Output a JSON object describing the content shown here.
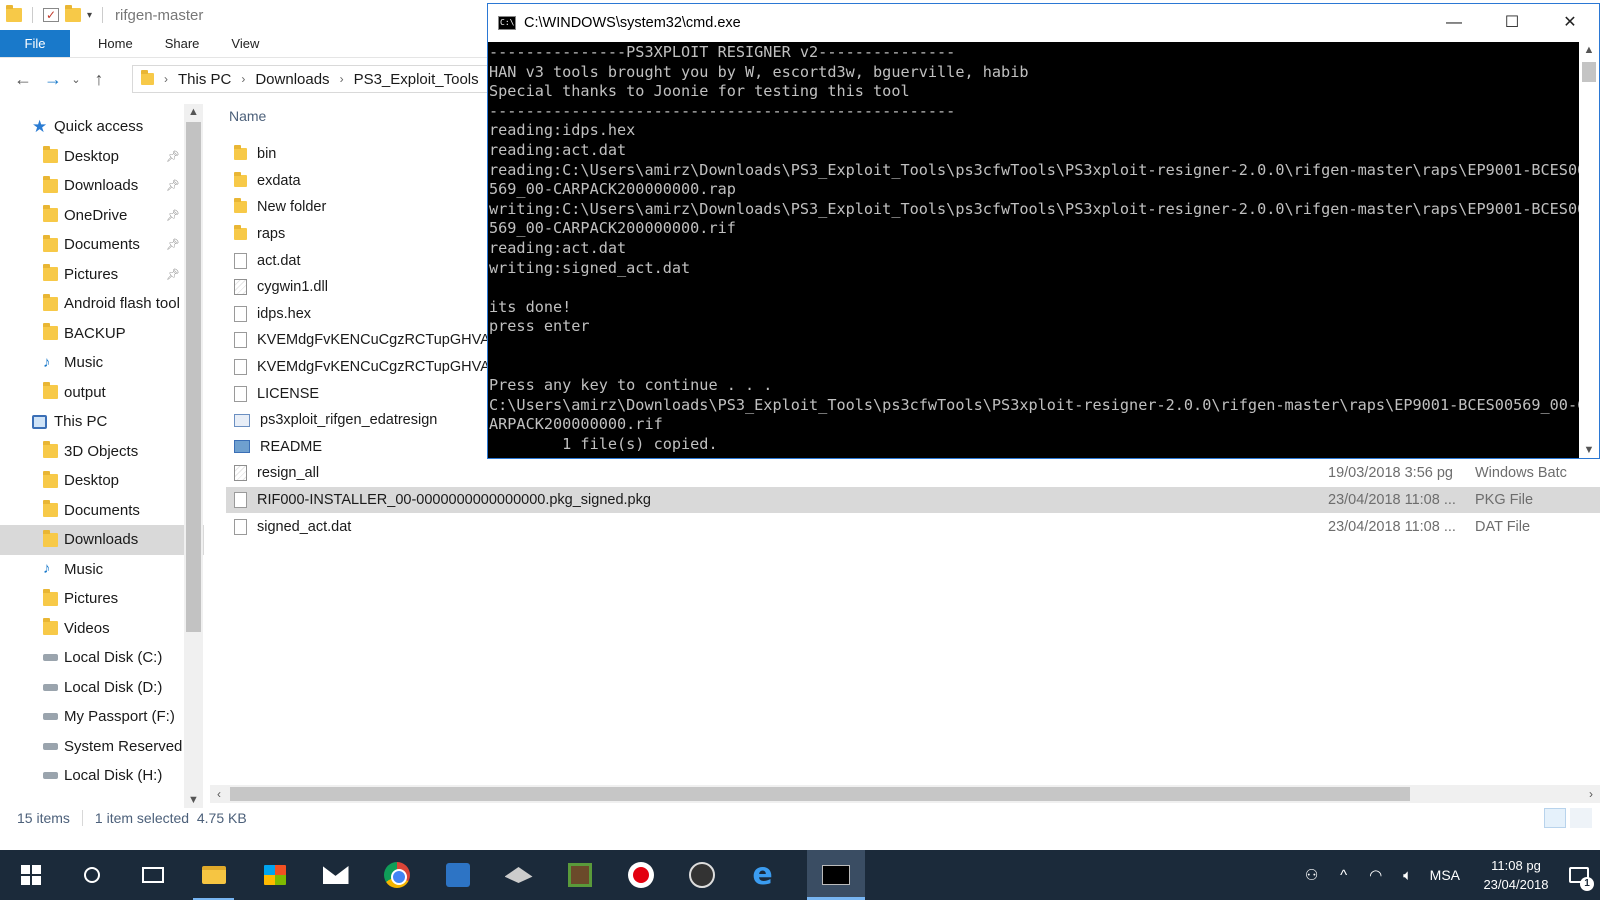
{
  "explorer": {
    "title": "rifgen-master",
    "ribbon_tabs": [
      "File",
      "Home",
      "Share",
      "View"
    ],
    "breadcrumb": [
      "This PC",
      "Downloads",
      "PS3_Exploit_Tools"
    ],
    "column_name": "Name",
    "sidebar": [
      {
        "label": "Quick access",
        "icon": "star-icon",
        "pinned": false,
        "top": true
      },
      {
        "label": "Desktop",
        "icon": "folder-icon",
        "pinned": true
      },
      {
        "label": "Downloads",
        "icon": "folder-icon",
        "pinned": true
      },
      {
        "label": "OneDrive",
        "icon": "folder-icon",
        "pinned": true
      },
      {
        "label": "Documents",
        "icon": "folder-icon",
        "pinned": true
      },
      {
        "label": "Pictures",
        "icon": "folder-icon",
        "pinned": true
      },
      {
        "label": "Android flash tool",
        "icon": "folder-icon",
        "pinned": false
      },
      {
        "label": "BACKUP",
        "icon": "folder-icon",
        "pinned": false
      },
      {
        "label": "Music",
        "icon": "music-icon",
        "pinned": false
      },
      {
        "label": "output",
        "icon": "folder-icon",
        "pinned": false
      },
      {
        "label": "This PC",
        "icon": "pc-icon",
        "pinned": false,
        "top": true
      },
      {
        "label": "3D Objects",
        "icon": "folder-icon",
        "pinned": false
      },
      {
        "label": "Desktop",
        "icon": "folder-icon",
        "pinned": false
      },
      {
        "label": "Documents",
        "icon": "folder-icon",
        "pinned": false
      },
      {
        "label": "Downloads",
        "icon": "folder-icon",
        "pinned": false,
        "selected": true
      },
      {
        "label": "Music",
        "icon": "music-icon",
        "pinned": false
      },
      {
        "label": "Pictures",
        "icon": "folder-icon",
        "pinned": false
      },
      {
        "label": "Videos",
        "icon": "folder-icon",
        "pinned": false
      },
      {
        "label": "Local Disk (C:)",
        "icon": "disk-icon",
        "pinned": false
      },
      {
        "label": "Local Disk (D:)",
        "icon": "disk-icon",
        "pinned": false
      },
      {
        "label": "My Passport (F:)",
        "icon": "disk-icon",
        "pinned": false
      },
      {
        "label": "System Reserved (",
        "icon": "disk-icon",
        "pinned": false
      },
      {
        "label": "Local Disk (H:)",
        "icon": "disk-icon",
        "pinned": false
      }
    ],
    "files": [
      {
        "name": "bin",
        "icon": "folder-icon",
        "date": "",
        "type": ""
      },
      {
        "name": "exdata",
        "icon": "folder-icon",
        "date": "",
        "type": ""
      },
      {
        "name": "New folder",
        "icon": "folder-icon",
        "date": "",
        "type": ""
      },
      {
        "name": "raps",
        "icon": "folder-icon",
        "date": "",
        "type": ""
      },
      {
        "name": "act.dat",
        "icon": "file-icon",
        "date": "",
        "type": ""
      },
      {
        "name": "cygwin1.dll",
        "icon": "dll-icon",
        "date": "",
        "type": ""
      },
      {
        "name": "idps.hex",
        "icon": "file-icon",
        "date": "",
        "type": ""
      },
      {
        "name": "KVEMdgFvKENCuCgzRCTupGHVAuN",
        "icon": "file-icon",
        "date": "",
        "type": ""
      },
      {
        "name": "KVEMdgFvKENCuCgzRCTupGHVAuN",
        "icon": "file-icon",
        "date": "",
        "type": ""
      },
      {
        "name": "LICENSE",
        "icon": "file-icon",
        "date": "",
        "type": ""
      },
      {
        "name": "ps3xploit_rifgen_edatresign",
        "icon": "exe-icon",
        "date": "",
        "type": ""
      },
      {
        "name": "README",
        "icon": "readme-icon",
        "date": "",
        "type": ""
      },
      {
        "name": "resign_all",
        "icon": "dll-icon",
        "date": "19/03/2018 3:56 pg",
        "type": "Windows Batc"
      },
      {
        "name": "RIF000-INSTALLER_00-0000000000000000.pkg_signed.pkg",
        "icon": "file-icon",
        "date": "23/04/2018 11:08 ...",
        "type": "PKG File",
        "selected": true
      },
      {
        "name": "signed_act.dat",
        "icon": "file-icon",
        "date": "23/04/2018 11:08 ...",
        "type": "DAT File"
      }
    ],
    "status": {
      "count": "15 items",
      "selection": "1 item selected  4.75 KB"
    }
  },
  "cmd": {
    "title": "C:\\WINDOWS\\system32\\cmd.exe",
    "lines": [
      "---------------PS3XPLOIT RESIGNER v2---------------",
      "HAN v3 tools brought you by W, escortd3w, bguerville, habib",
      "Special thanks to Joonie for testing this tool",
      "---------------------------------------------------",
      "reading:idps.hex",
      "reading:act.dat",
      "reading:C:\\Users\\amirz\\Downloads\\PS3_Exploit_Tools\\ps3cfwTools\\PS3xploit-resigner-2.0.0\\rifgen-master\\raps\\EP9001-BCES00",
      "569_00-CARPACK200000000.rap",
      "writing:C:\\Users\\amirz\\Downloads\\PS3_Exploit_Tools\\ps3cfwTools\\PS3xploit-resigner-2.0.0\\rifgen-master\\raps\\EP9001-BCES00",
      "569_00-CARPACK200000000.rif",
      "reading:act.dat",
      "writing:signed_act.dat",
      "",
      "its done!",
      "press enter",
      "",
      "",
      "Press any key to continue . . .",
      "C:\\Users\\amirz\\Downloads\\PS3_Exploit_Tools\\ps3cfwTools\\PS3xploit-resigner-2.0.0\\rifgen-master\\raps\\EP9001-BCES00569_00-C",
      "ARPACK200000000.rif",
      "        1 file(s) copied."
    ]
  },
  "taskbar": {
    "apps": [
      {
        "name": "start-button",
        "icon": "windows-logo-icon"
      },
      {
        "name": "search-button",
        "icon": "search-icon"
      },
      {
        "name": "task-view-button",
        "icon": "task-view-icon"
      },
      {
        "name": "file-explorer-app",
        "icon": "folder-icon",
        "running": true
      },
      {
        "name": "store-app",
        "icon": "store-icon"
      },
      {
        "name": "mail-app",
        "icon": "mail-icon"
      },
      {
        "name": "chrome-app",
        "icon": "chrome-icon"
      },
      {
        "name": "ps3-tool-app",
        "icon": "ps3-icon"
      },
      {
        "name": "dark-app",
        "icon": "diamond-icon"
      },
      {
        "name": "minecraft-app",
        "icon": "minecraft-icon"
      },
      {
        "name": "recorder-app",
        "icon": "record-icon"
      },
      {
        "name": "obs-app",
        "icon": "obs-icon"
      },
      {
        "name": "edge-app",
        "icon": "edge-icon"
      },
      {
        "name": "cmd-app",
        "icon": "cmd-icon",
        "active": true
      }
    ],
    "language": "MSA",
    "time": "11:08 pg",
    "date": "23/04/2018",
    "notifications": "1"
  }
}
